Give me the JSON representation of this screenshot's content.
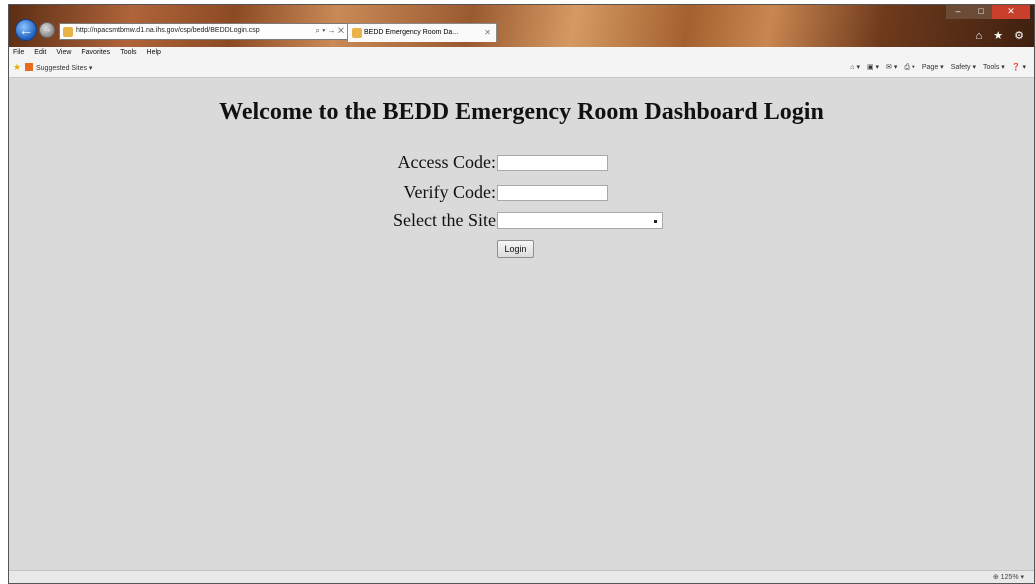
{
  "browser": {
    "address_url": "http://npacsmtbmw.d1.na.ihs.gov/csp/bedd/BEDDLogin.csp",
    "address_tools": "⌕ ▾ → ✕",
    "tab_title": "BEDD Emergency Room Da...",
    "tab_close": "✕",
    "toolbar_icons": "⌂ ★ ⚙",
    "window_controls": {
      "minimize": "–",
      "maximize": "□",
      "close": "✕"
    }
  },
  "menu": [
    "File",
    "Edit",
    "View",
    "Favorites",
    "Tools",
    "Help"
  ],
  "favorites": {
    "suggested": "Suggested Sites ▾"
  },
  "command_bar": [
    "⌂ ▾",
    "▣ ▾",
    "✉ ▾",
    "⎙ ▾",
    "Page ▾",
    "Safety ▾",
    "Tools ▾",
    "❓ ▾"
  ],
  "page": {
    "title": "Welcome to the BEDD Emergency Room Dashboard Login",
    "access_code_label": "Access Code:",
    "verify_code_label": "Verify Code:",
    "site_label": "Select the Site",
    "login_button": "Login"
  },
  "status": {
    "zoom": "⊕ 125% ▾"
  }
}
